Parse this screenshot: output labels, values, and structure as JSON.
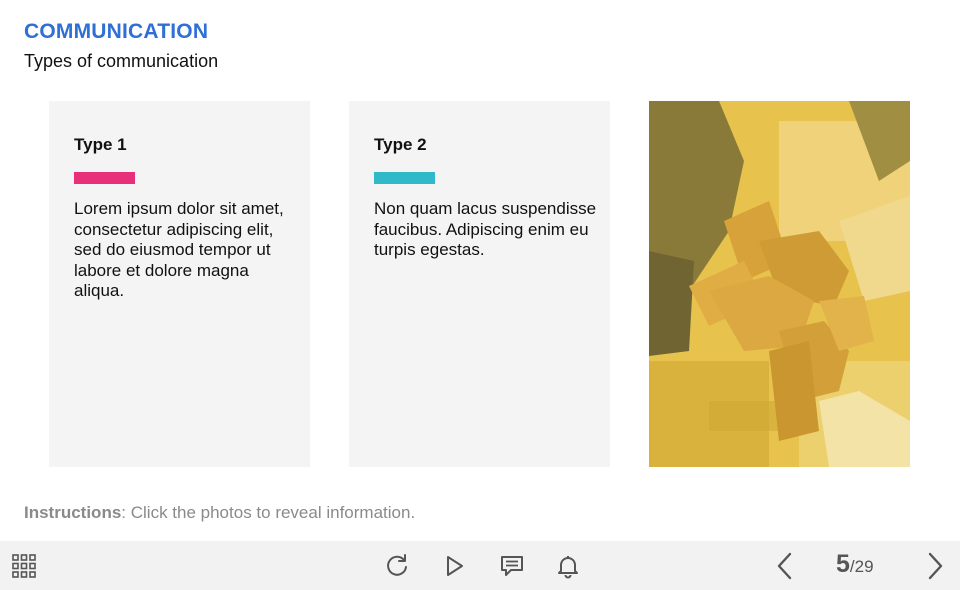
{
  "header": {
    "title": "COMMUNICATION",
    "subtitle": "Types of communication"
  },
  "cards": [
    {
      "title": "Type 1",
      "accent": "#e8307a",
      "text": "Lorem ipsum dolor sit amet, consectetur adipiscing elit, sed do eiusmod tempor ut labore et dolore magna aliqua."
    },
    {
      "title": "Type 2",
      "accent": "#2fb9c9",
      "text": "Non quam lacus suspendisse faucibus. Adipiscing enim eu turpis egestas."
    }
  ],
  "photo": {
    "icon": "team-hands-photo",
    "tint": "#e8c548"
  },
  "instructions": {
    "label": "Instructions",
    "text": ": Click the photos to reveal information."
  },
  "toolbar": {
    "menu_icon": "grid-menu-icon",
    "replay_icon": "replay-icon",
    "play_icon": "play-icon",
    "captions_icon": "captions-icon",
    "notes_icon": "bell-icon",
    "prev_icon": "chevron-left-icon",
    "next_icon": "chevron-right-icon",
    "current_page": "5",
    "total_pages": "/29"
  },
  "colors": {
    "title": "#2f6fd6",
    "card_bg": "#f4f4f4",
    "toolbar_bg": "#f2f2f2"
  }
}
